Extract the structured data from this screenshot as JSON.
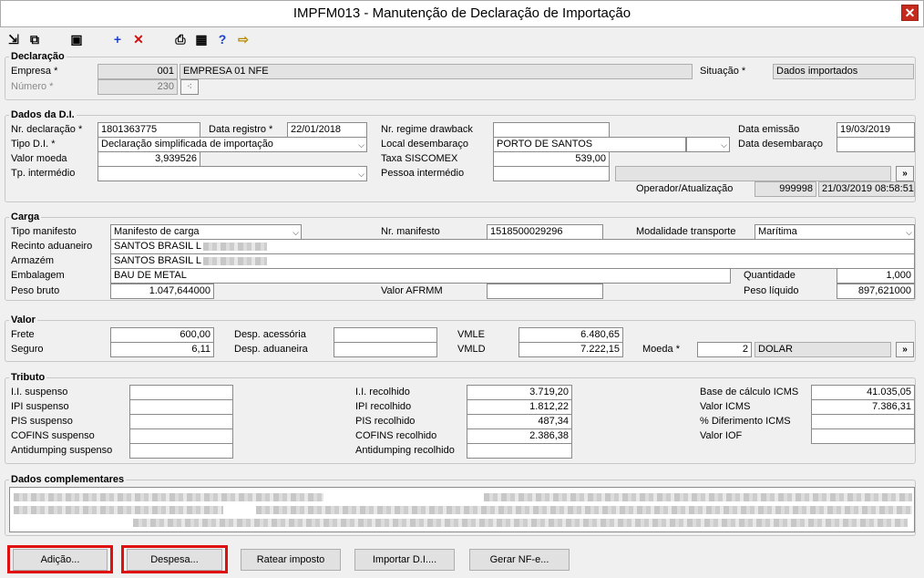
{
  "window": {
    "title": "IMPFM013 - Manutenção de Declaração de Importação",
    "close": "✕"
  },
  "toolbar": {
    "i1": "⇲",
    "i2": "⧉",
    "save": "▣",
    "add": "+",
    "delete": "✕",
    "print": "⎙",
    "calc": "▦",
    "help": "?",
    "exit": "⇨"
  },
  "declaracao": {
    "title": "Declaração",
    "empresa_label": "Empresa *",
    "empresa_code": "001",
    "empresa_name": "EMPRESA 01 NFE",
    "numero_label": "Número *",
    "numero_value": "230",
    "situacao_label": "Situação *",
    "situacao_value": "Dados importados"
  },
  "dados_di": {
    "title": "Dados da D.I.",
    "nr_decl_label": "Nr. declaração *",
    "nr_decl_value": "1801363775",
    "data_registro_label": "Data registro *",
    "data_registro_value": "22/01/2018",
    "nr_regime_label": "Nr. regime drawback",
    "nr_regime_value": "",
    "data_emissao_label": "Data emissão",
    "data_emissao_value": "19/03/2019",
    "tipo_di_label": "Tipo D.I. *",
    "tipo_di_value": "Declaração simplificada de importação",
    "local_desemb_label": "Local desembaraço",
    "local_desemb_value": "PORTO DE SANTOS",
    "data_desemb_label": "Data desembaraço",
    "data_desemb_value": "",
    "valor_moeda_label": "Valor moeda",
    "valor_moeda_value": "3,939526",
    "taxa_siscomex_label": "Taxa SISCOMEX",
    "taxa_siscomex_value": "539,00",
    "tp_intermedio_label": "Tp. intermédio",
    "tp_intermedio_value": "",
    "pessoa_intermedio_label": "Pessoa intermédio",
    "pessoa_intermedio_value": "",
    "operador_label": "Operador/Atualização",
    "operador_value": "999998",
    "atualizacao_value": "21/03/2019 08:58:51"
  },
  "carga": {
    "title": "Carga",
    "tipo_manifesto_label": "Tipo manifesto",
    "tipo_manifesto_value": "Manifesto de carga",
    "nr_manifesto_label": "Nr. manifesto",
    "nr_manifesto_value": "1518500029296",
    "modalidade_label": "Modalidade transporte",
    "modalidade_value": "Marítima",
    "recinto_label": "Recinto aduaneiro",
    "recinto_value": "SANTOS BRASIL L",
    "armazem_label": "Armazém",
    "armazem_value": "SANTOS BRASIL L",
    "embalagem_label": "Embalagem",
    "embalagem_value": "BAU DE METAL",
    "quantidade_label": "Quantidade",
    "quantidade_value": "1,000",
    "peso_bruto_label": "Peso bruto",
    "peso_bruto_value": "1.047,644000",
    "valor_afrmm_label": "Valor AFRMM",
    "valor_afrmm_value": "",
    "peso_liquido_label": "Peso líquido",
    "peso_liquido_value": "897,621000"
  },
  "valor": {
    "title": "Valor",
    "frete_label": "Frete",
    "frete_value": "600,00",
    "seguro_label": "Seguro",
    "seguro_value": "6,11",
    "desp_acess_label": "Desp. acessória",
    "desp_acess_value": "",
    "desp_adua_label": "Desp. aduaneira",
    "desp_adua_value": "",
    "vmle_label": "VMLE",
    "vmle_value": "6.480,65",
    "vmld_label": "VMLD",
    "vmld_value": "7.222,15",
    "moeda_label": "Moeda *",
    "moeda_code": "2",
    "moeda_name": "DOLAR"
  },
  "tributo": {
    "title": "Tributo",
    "ii_susp_label": "I.I. suspenso",
    "ipi_susp_label": "IPI suspenso",
    "pis_susp_label": "PIS suspenso",
    "cofins_susp_label": "COFINS suspenso",
    "antidump_susp_label": "Antidumping suspenso",
    "ii_rec_label": "I.I. recolhido",
    "ii_rec_value": "3.719,20",
    "ipi_rec_label": "IPI recolhido",
    "ipi_rec_value": "1.812,22",
    "pis_rec_label": "PIS recolhido",
    "pis_rec_value": "487,34",
    "cofins_rec_label": "COFINS recolhido",
    "cofins_rec_value": "2.386,38",
    "antidump_rec_label": "Antidumping recolhido",
    "base_icms_label": "Base de cálculo ICMS",
    "base_icms_value": "41.035,05",
    "valor_icms_label": "Valor ICMS",
    "valor_icms_value": "7.386,31",
    "dif_icms_label": "% Diferimento ICMS",
    "valor_iof_label": "Valor IOF"
  },
  "complementares": {
    "title": "Dados complementares"
  },
  "buttons": {
    "adicao": "Adição...",
    "despesa": "Despesa...",
    "ratear": "Ratear imposto",
    "importar": "Importar D.I....",
    "gerar_nf": "Gerar NF-e..."
  },
  "more_glyph": "»",
  "dropdown_glyph": "⌵"
}
